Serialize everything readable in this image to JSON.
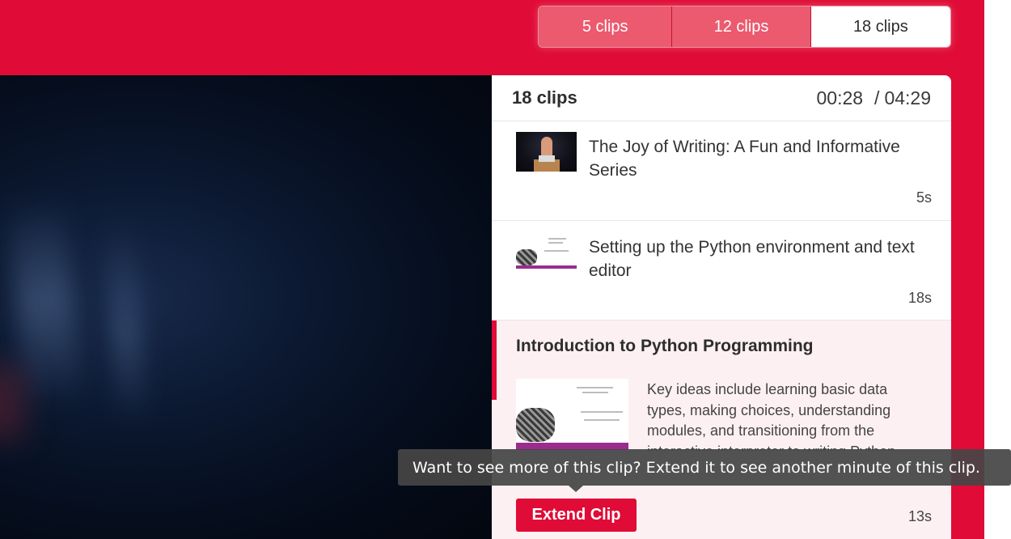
{
  "clip_tabs": [
    {
      "label": "5 clips",
      "selected": false
    },
    {
      "label": "12 clips",
      "selected": false
    },
    {
      "label": "18 clips",
      "selected": true
    }
  ],
  "panel": {
    "title": "18 clips",
    "current_time": "00:28",
    "separator": "/",
    "total_time": "04:29"
  },
  "clips": [
    {
      "title": "The Joy of Writing: A Fun and Informative Series",
      "duration": "5s",
      "thumbnail": "speaker-on-stage"
    },
    {
      "title": "Setting up the Python environment and text editor",
      "duration": "18s",
      "thumbnail": "python-slide"
    }
  ],
  "active_clip": {
    "title": "Introduction to Python Programming",
    "description": "Key ideas include learning basic data types, making choices, understanding modules, and transitioning from the interactive interpreter to writing Python",
    "duration": "13s",
    "thumbnail": "python-slide",
    "extend_label": "Extend Clip"
  },
  "tooltip": {
    "text": "Want to see more of this clip? Extend it to see another minute of this clip."
  },
  "colors": {
    "brand_red": "#e00b36",
    "tab_inactive": "#eb5a6e",
    "active_bg": "#fdf0f2"
  }
}
